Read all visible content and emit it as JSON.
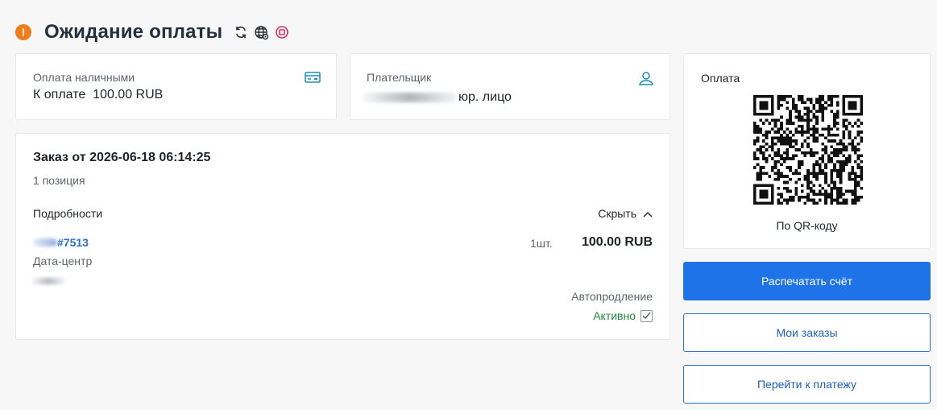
{
  "header": {
    "title": "Ожидание оплаты",
    "status_icon": "warning-icon",
    "actions": [
      "refresh-icon",
      "globe-icon",
      "stop-icon"
    ],
    "colors": {
      "warning": "#ef7d1a",
      "stop": "#d8335d"
    }
  },
  "payment_card": {
    "method_label": "Оплата наличными",
    "amount_text": "К оплате  100.00 RUB",
    "icon": "credit-card-icon"
  },
  "payer_card": {
    "label": "Плательщик",
    "type_text": "юр. лицо",
    "icon": "user-icon"
  },
  "order": {
    "title": "Заказ от 2026-06-18 06:14:25",
    "count_text": "1 позиция",
    "details_label": "Подробности",
    "toggle_label": "Скрыть",
    "item": {
      "id_text": "#7513",
      "subtitle": "Дата-центр",
      "quantity": "1шт.",
      "price": "100.00 RUB"
    },
    "autorenew": {
      "label": "Автопродление",
      "status": "Активно",
      "checked": true
    }
  },
  "qr_card": {
    "label": "Оплата",
    "caption": "По QR-коду"
  },
  "buttons": {
    "print_invoice": "Распечатать счёт",
    "my_orders": "Мои заказы",
    "go_to_payment": "Перейти к платежу"
  },
  "colors": {
    "primary": "#1f73e8",
    "link": "#2a6fd4",
    "active": "#1f8a3b"
  }
}
